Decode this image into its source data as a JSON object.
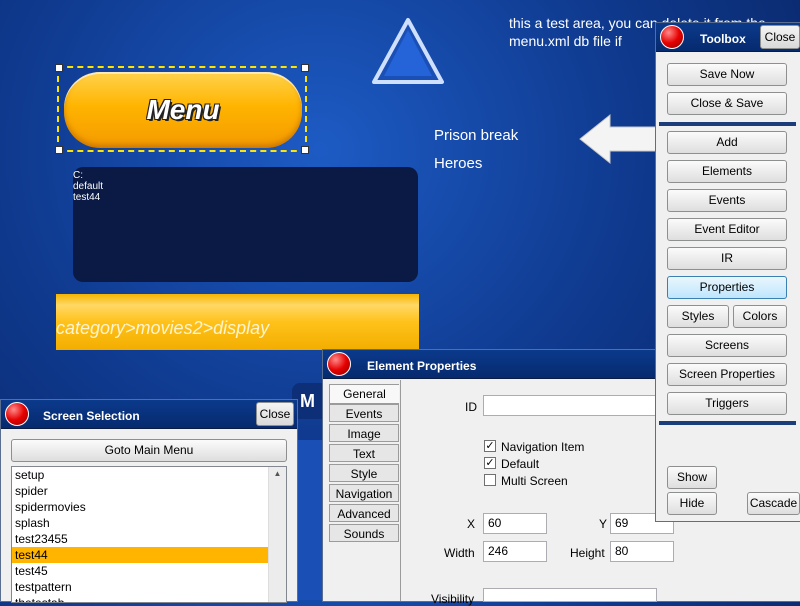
{
  "canvas": {
    "menu_label": "Menu",
    "list_items": [
      "C:",
      "default",
      "test44"
    ],
    "breadcrumb": "category>movies2>display",
    "note": "this a test area, you can delete it from the menu.xml db file if",
    "shows": [
      "Prison break",
      "Heroes"
    ],
    "partial_label": "M"
  },
  "toolbox": {
    "title": "Toolbox",
    "close_label": "Close",
    "buttons": {
      "save_now": "Save Now",
      "close_save": "Close & Save",
      "add": "Add",
      "elements": "Elements",
      "events": "Events",
      "event_editor": "Event Editor",
      "ir": "IR",
      "properties": "Properties",
      "styles": "Styles",
      "colors": "Colors",
      "screens": "Screens",
      "screen_properties": "Screen Properties",
      "triggers": "Triggers",
      "show": "Show",
      "hide": "Hide",
      "cascade": "Cascade"
    }
  },
  "element_properties": {
    "title": "Element Properties",
    "tabs": [
      "General",
      "Events",
      "Image",
      "Text",
      "Style",
      "Navigation",
      "Advanced",
      "Sounds"
    ],
    "active_tab": "General",
    "fields": {
      "id_label": "ID",
      "id_value": "",
      "navigation_item_label": "Navigation Item",
      "navigation_item_checked": true,
      "default_label": "Default",
      "default_checked": true,
      "multi_screen_label": "Multi Screen",
      "multi_screen_checked": false,
      "x_label": "X",
      "x_value": "60",
      "y_label": "Y",
      "y_value": "69",
      "width_label": "Width",
      "width_value": "246",
      "height_label": "Height",
      "height_value": "80",
      "visibility_label": "Visibility"
    }
  },
  "screen_selection": {
    "title": "Screen Selection",
    "close_label": "Close",
    "goto_label": "Goto Main Menu",
    "screens": [
      "setup",
      "spider",
      "spidermovies",
      "splash",
      "test23455",
      "test44",
      "test45",
      "testpattern",
      "thetestab"
    ],
    "selected": "test44"
  },
  "colors": {
    "accent": "#ffb400",
    "title_bar": "#0b3a8c",
    "background": "#0f3a8f"
  }
}
